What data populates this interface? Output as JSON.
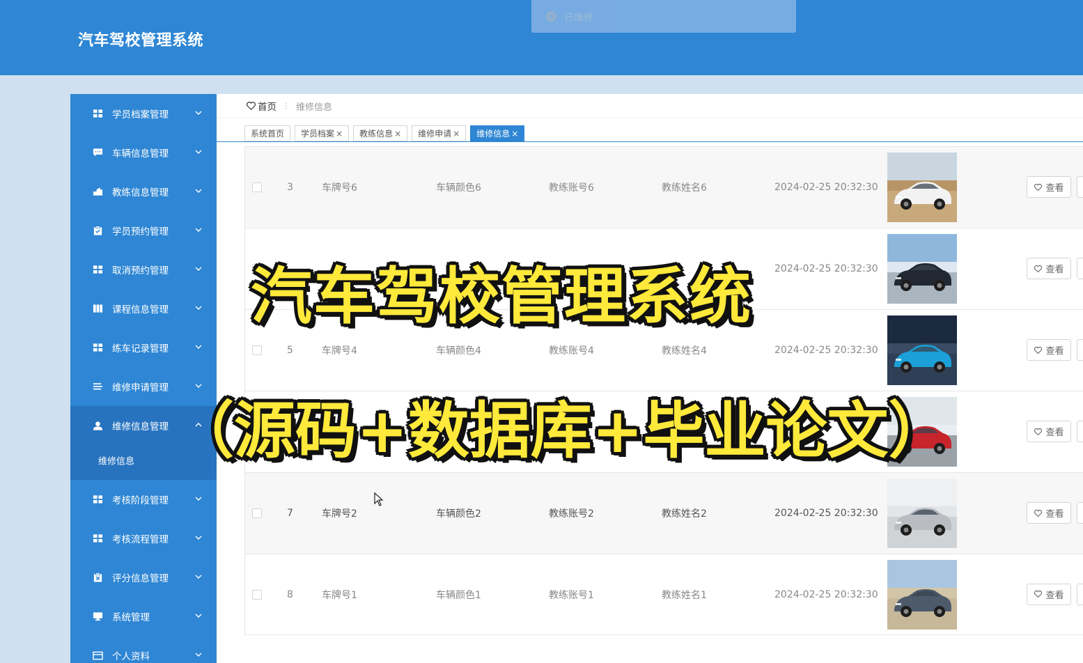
{
  "app": {
    "title": "汽车驾校管理系统"
  },
  "toast": {
    "text": "已维修",
    "icon": "close-circle-icon"
  },
  "sidebar": {
    "items": [
      {
        "label": "学员档案管理",
        "icon": "grid-icon"
      },
      {
        "label": "车辆信息管理",
        "icon": "chat-icon"
      },
      {
        "label": "教练信息管理",
        "icon": "tools-icon"
      },
      {
        "label": "学员预约管理",
        "icon": "clipboard-icon"
      },
      {
        "label": "取消预约管理",
        "icon": "grid-icon"
      },
      {
        "label": "课程信息管理",
        "icon": "book-icon"
      },
      {
        "label": "练车记录管理",
        "icon": "grid-icon"
      },
      {
        "label": "维修申请管理",
        "icon": "list-icon"
      },
      {
        "label": "维修信息管理",
        "icon": "user-icon",
        "active": true
      },
      {
        "label": "考核阶段管理",
        "icon": "grid-icon"
      },
      {
        "label": "考核流程管理",
        "icon": "grid-icon"
      },
      {
        "label": "评分信息管理",
        "icon": "clipboard-x-icon"
      },
      {
        "label": "系统管理",
        "icon": "monitor-icon"
      },
      {
        "label": "个人资料",
        "icon": "card-icon"
      }
    ],
    "submenu": {
      "label": "维修信息"
    }
  },
  "breadcrumb": {
    "home": "首页",
    "separator": "⋮",
    "current": "维修信息"
  },
  "tabs": [
    {
      "label": "系统首页",
      "closable": false
    },
    {
      "label": "学员档案",
      "closable": true
    },
    {
      "label": "教练信息",
      "closable": true
    },
    {
      "label": "维修申请",
      "closable": true
    },
    {
      "label": "维修信息",
      "closable": true,
      "active": true
    }
  ],
  "table": {
    "view_label": "查看",
    "rows": [
      {
        "id": "3",
        "plate": "车牌号6",
        "color": "车辆颜色6",
        "account": "教练账号6",
        "name": "教练姓名6",
        "time": "2024-02-25 20:32:30",
        "image": "white-sedan"
      },
      {
        "id": "",
        "plate": "",
        "color": "",
        "account": "",
        "name": "",
        "time": "2024-02-25 20:32:30",
        "image": "black-suv"
      },
      {
        "id": "5",
        "plate": "车牌号4",
        "color": "车辆颜色4",
        "account": "教练账号4",
        "name": "教练姓名4",
        "time": "2024-02-25 20:32:30",
        "image": "blue-suv"
      },
      {
        "id": "",
        "plate": "",
        "color": "",
        "account": "",
        "name": "",
        "time": "",
        "image": "red-sports-car"
      },
      {
        "id": "7",
        "plate": "车牌号2",
        "color": "车辆颜色2",
        "account": "教练账号2",
        "name": "教练姓名2",
        "time": "2024-02-25 20:32:30",
        "image": "silver-crossover"
      },
      {
        "id": "8",
        "plate": "车牌号1",
        "color": "车辆颜色1",
        "account": "教练账号1",
        "name": "教练姓名1",
        "time": "2024-02-25 20:32:30",
        "image": "grey-wagon"
      }
    ]
  },
  "overlay": {
    "title": "汽车驾校管理系统",
    "subtitle": "（源码+数据库+毕业论文）"
  }
}
